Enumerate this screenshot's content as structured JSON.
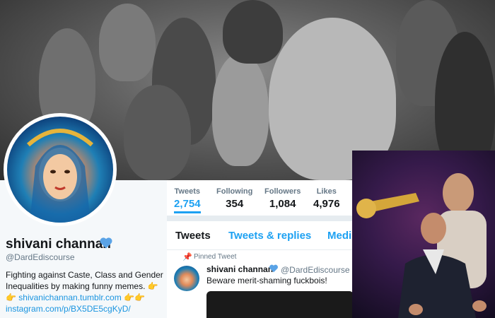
{
  "profile": {
    "name": "shivani channan",
    "handle": "@DardEdiscourse",
    "bio": "Fighting against Caste, Class and Gender Inequalities by making funny memes.",
    "emoji_point": "👉",
    "link_tumblr": "shivanichannan.tumblr.com",
    "link_instagram": "instagram.com/p/BX5DE5cgKyD/"
  },
  "stats": [
    {
      "label": "Tweets",
      "value": "2,754"
    },
    {
      "label": "Following",
      "value": "354"
    },
    {
      "label": "Followers",
      "value": "1,084"
    },
    {
      "label": "Likes",
      "value": "4,976"
    }
  ],
  "tabs": [
    "Tweets",
    "Tweets & replies",
    "Medi"
  ],
  "pinned_tweet": {
    "label": "Pinned Tweet",
    "author": "shivani channan",
    "handle": "@DardEdiscourse · S",
    "text": "Beware merit-shaming fuckbois!"
  },
  "colors": {
    "accent": "#1da1f2",
    "text": "#14171a",
    "muted": "#657786"
  },
  "icons": [
    "heart-emoji-icon",
    "pin-icon",
    "pointing-hand-icon"
  ]
}
